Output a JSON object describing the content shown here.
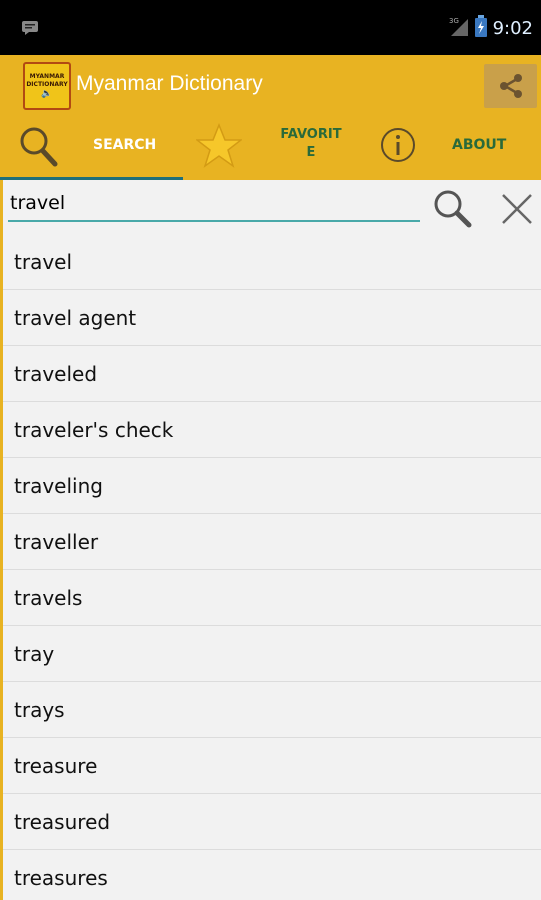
{
  "status_bar": {
    "time": "9:02",
    "network": "3G",
    "icons": [
      "notification-icon",
      "signal-icon",
      "battery-icon"
    ]
  },
  "app_bar": {
    "title": "Myanmar Dictionary",
    "logo_text_top": "MYANMAR",
    "logo_text_bottom": "DICTIONARY",
    "share_icon": "share-icon",
    "color": "#E8B322"
  },
  "tabs": [
    {
      "label": "SEARCH",
      "icon": "search-icon",
      "selected": true
    },
    {
      "label": "FAVORITE",
      "icon": "star-icon",
      "selected": false
    },
    {
      "label": "ABOUT",
      "icon": "info-icon",
      "selected": false
    }
  ],
  "search": {
    "value": "travel",
    "search_icon": "search-icon",
    "clear_icon": "close-icon"
  },
  "results": [
    "travel",
    "travel agent",
    "traveled",
    "traveler's check",
    "traveling",
    "traveller",
    "travels",
    "tray",
    "trays",
    "treasure",
    "treasured",
    "treasures"
  ]
}
